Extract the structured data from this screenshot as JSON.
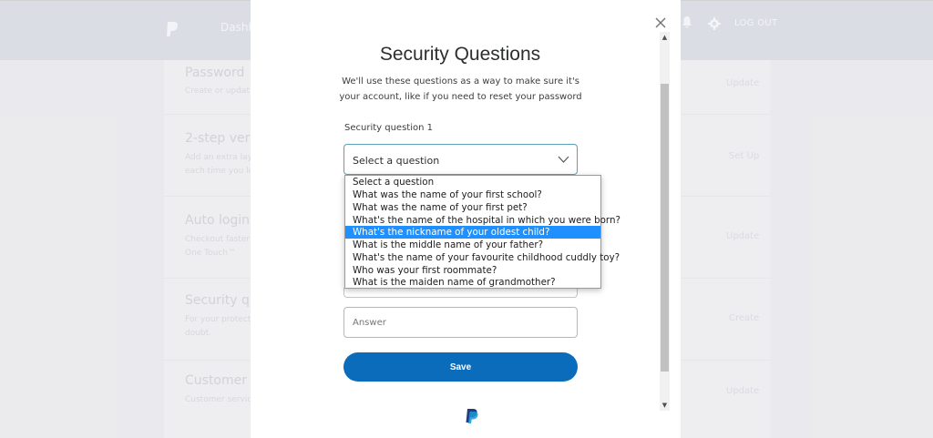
{
  "header": {
    "nav_dashboard": "Dashb",
    "logout_label": "LOG OUT"
  },
  "background_rows": [
    {
      "title": "Password",
      "desc": "Create or updat",
      "action": "Update"
    },
    {
      "title": "2-step verif",
      "desc": "Add an extra lay each time you lo",
      "action": "Set Up"
    },
    {
      "title": "Auto login",
      "desc": "Checkout faster One Touch™",
      "action": "Update"
    },
    {
      "title": "Security que",
      "desc": "For your protect doubt.",
      "action": "Create"
    },
    {
      "title": "Customer se",
      "desc": "Customer servic",
      "action": "Update"
    }
  ],
  "modal": {
    "title": "Security Questions",
    "subtitle": "We'll use these questions as a way to make sure it's your account, like if you need to reset your password",
    "question1_label": "Security question 1",
    "select_value": "Select a question",
    "options": [
      "Select a question",
      "What was the name of your first school?",
      "What was the name of your first pet?",
      "What's the name of the hospital in which you were born?",
      "What's the nickname of your oldest child?",
      "What is the middle name of your father?",
      "What's the name of your favourite childhood cuddly toy?",
      "Who was your first roommate?",
      "What is the maiden name of grandmother?"
    ],
    "selected_option_index": 4,
    "answer_placeholder": "Answer",
    "save_label": "Save"
  },
  "colors": {
    "primary_button": "#0b6cbc",
    "selected_option": "#1e90ff",
    "select_border_focus": "#5ca0b8"
  },
  "icons": [
    "paypal-logo-icon",
    "bell-icon",
    "gear-icon",
    "close-icon",
    "chevron-down-icon"
  ]
}
